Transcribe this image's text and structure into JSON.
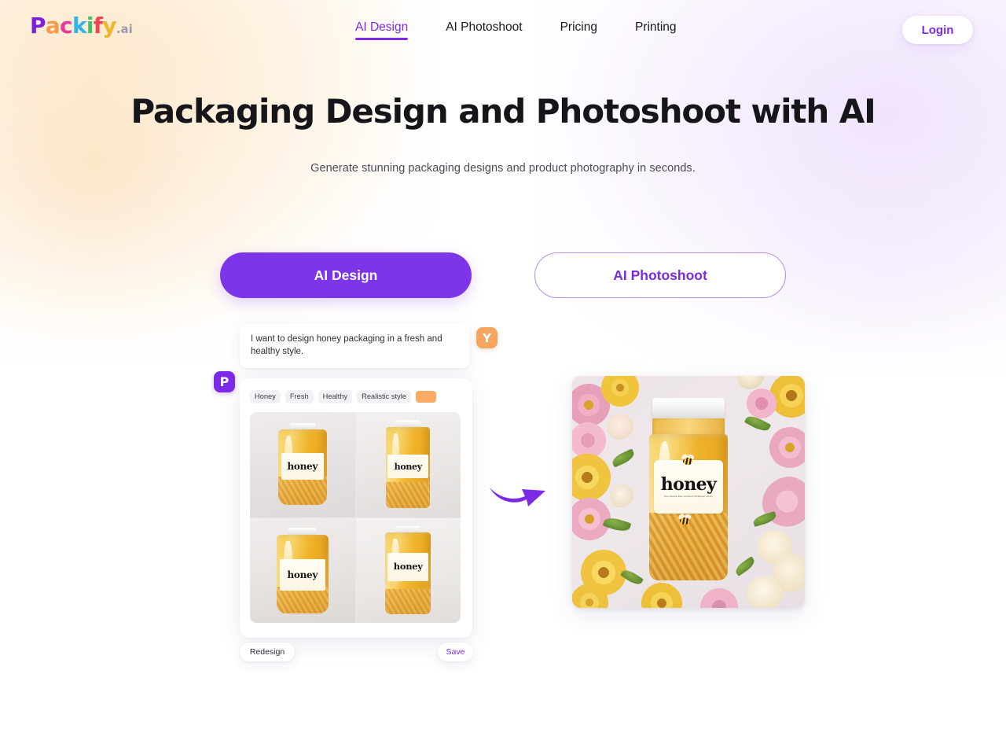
{
  "brand": {
    "name": "Packify.ai",
    "letters": [
      {
        "ch": "P",
        "color": "#7c1fd6"
      },
      {
        "ch": "a",
        "color": "#f59b4e"
      },
      {
        "ch": "c",
        "color": "#e8399b"
      },
      {
        "ch": "k",
        "color": "#2eb6e8"
      },
      {
        "ch": "i",
        "color": "#3fc06a"
      },
      {
        "ch": "f",
        "color": "#f0464f"
      },
      {
        "ch": "y",
        "color": "#f0b62b"
      }
    ],
    "suffix": ".ai",
    "suffix_color": "#9b9aa4"
  },
  "colors": {
    "accent_purple": "#7c2ae8",
    "cta_purple": "#7c35e8",
    "orange": "#f5a65e",
    "tag_bg": "#f2f2f5",
    "swatch_orange": "#f7ab63"
  },
  "nav": {
    "items": [
      {
        "label": "AI Design",
        "active": true
      },
      {
        "label": "AI Photoshoot",
        "active": false
      },
      {
        "label": "Pricing",
        "active": false
      },
      {
        "label": "Printing",
        "active": false
      }
    ],
    "login_label": "Login"
  },
  "hero": {
    "title": "Packaging Design and Photoshoot with AI",
    "subtitle": "Generate stunning packaging designs and product photography in seconds."
  },
  "cta": {
    "primary_label": "AI Design",
    "secondary_label": "AI Photoshoot"
  },
  "demo": {
    "user_avatar_initial": "Y",
    "assistant_avatar_initial": "P",
    "user_message": "I want to design honey packaging in a fresh and healthy style.",
    "tags": [
      "Honey",
      "Fresh",
      "Healthy",
      "Realistic style"
    ],
    "color_swatch": "#f7ab63",
    "redesign_label": "Redesign",
    "save_label": "Save",
    "grid_label_text": "honey",
    "result_label_text": "honey",
    "result_label_sub": "Pure Natural Raw Unfiltered Wildflower Honey"
  }
}
